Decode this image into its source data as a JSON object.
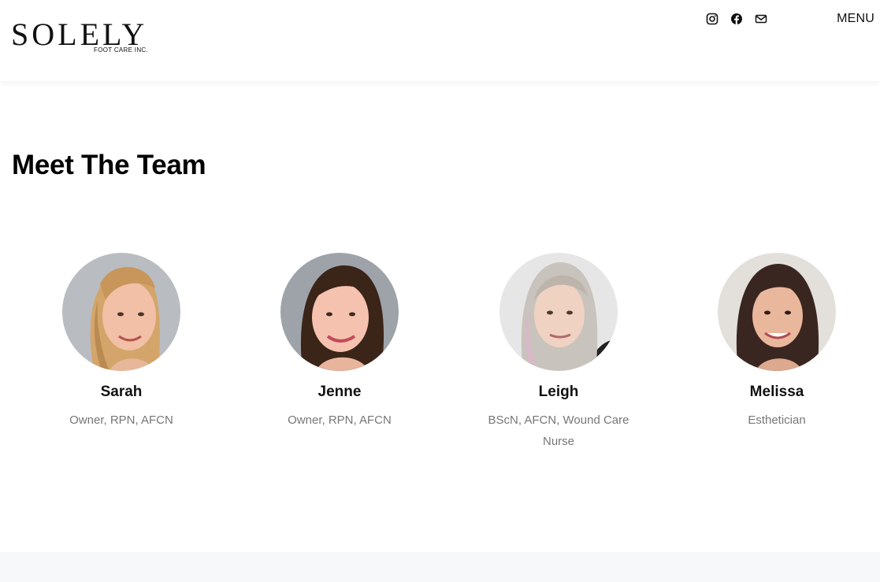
{
  "header": {
    "logo_main": "SOLELY",
    "logo_sub": "FOOT CARE INC.",
    "social_icons": [
      "instagram-icon",
      "facebook-icon",
      "email-icon"
    ],
    "menu_label": "MENU"
  },
  "section": {
    "title": "Meet The Team"
  },
  "team": [
    {
      "name": "Sarah",
      "role": "Owner, RPN, AFCN"
    },
    {
      "name": "Jenne",
      "role": "Owner, RPN, AFCN"
    },
    {
      "name": "Leigh",
      "role": "BScN, AFCN, Wound Care Nurse"
    },
    {
      "name": "Melissa",
      "role": "Esthetician"
    }
  ],
  "colors": {
    "text": "#111111",
    "muted": "#777777",
    "footer_band": "#f7f8fa"
  }
}
